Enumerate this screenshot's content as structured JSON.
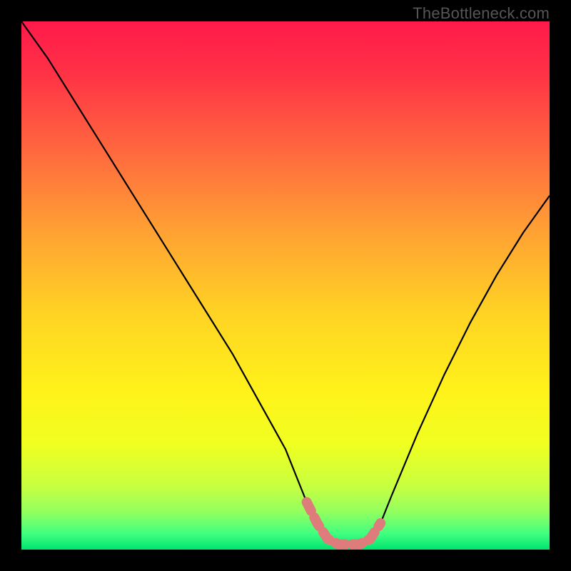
{
  "watermark": "TheBottleneck.com",
  "chart_data": {
    "type": "line",
    "title": "",
    "xlabel": "",
    "ylabel": "",
    "xlim": [
      0,
      100
    ],
    "ylim": [
      0,
      100
    ],
    "series": [
      {
        "name": "bottleneck-curve",
        "color": "#000000",
        "x": [
          0,
          5,
          10,
          15,
          20,
          25,
          30,
          35,
          40,
          45,
          50,
          52,
          54,
          56,
          58,
          60,
          62,
          64,
          66,
          68,
          70,
          75,
          80,
          85,
          90,
          95,
          100
        ],
        "y": [
          100,
          93,
          85,
          77,
          69,
          61,
          53,
          45,
          37,
          28,
          19,
          14,
          9,
          5,
          2,
          1,
          1,
          1,
          2,
          5,
          10,
          22,
          33,
          43,
          52,
          60,
          67
        ]
      },
      {
        "name": "bottom-highlight",
        "color": "#de7b7b",
        "x": [
          54,
          56,
          58,
          60,
          62,
          64,
          66,
          68
        ],
        "y": [
          9,
          5,
          2,
          1,
          1,
          1,
          2,
          5
        ]
      }
    ],
    "background_gradient": {
      "stops": [
        {
          "offset": 0.0,
          "color": "#ff1a4a"
        },
        {
          "offset": 0.1,
          "color": "#ff3246"
        },
        {
          "offset": 0.25,
          "color": "#ff6a3e"
        },
        {
          "offset": 0.4,
          "color": "#ffa233"
        },
        {
          "offset": 0.55,
          "color": "#ffd224"
        },
        {
          "offset": 0.7,
          "color": "#fff21a"
        },
        {
          "offset": 0.8,
          "color": "#f0ff20"
        },
        {
          "offset": 0.88,
          "color": "#c8ff40"
        },
        {
          "offset": 0.93,
          "color": "#90ff60"
        },
        {
          "offset": 0.97,
          "color": "#40ff80"
        },
        {
          "offset": 1.0,
          "color": "#00e56f"
        }
      ]
    }
  }
}
